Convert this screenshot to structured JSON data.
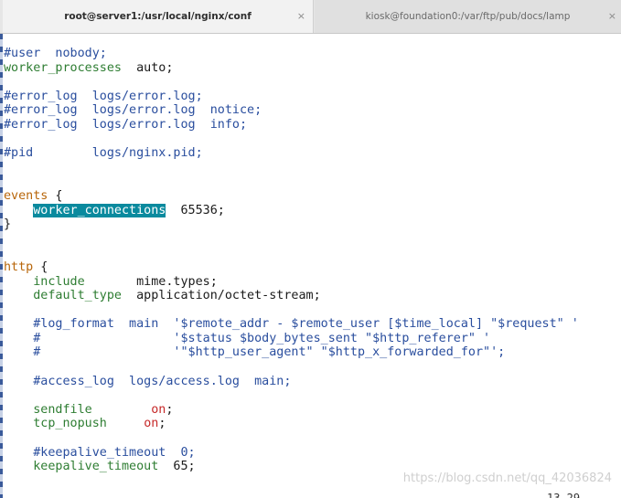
{
  "tabs": [
    {
      "title": "root@server1:/usr/local/nginx/conf",
      "close": "×",
      "active": true
    },
    {
      "title": "kiosk@foundation0:/var/ftp/pub/docs/lamp",
      "close": "×",
      "active": false
    }
  ],
  "colors": {
    "comment": "#2a4e9e",
    "directive": "#2e7d32",
    "keyword": "#b8660a",
    "value_on": "#c62828",
    "highlight_bg": "#0a8a9e"
  },
  "lines": [
    [
      {
        "t": "#user  nobody;",
        "c": "comment"
      }
    ],
    [
      {
        "t": "worker_processes",
        "c": "key"
      },
      {
        "t": "  auto;",
        "c": "plain"
      }
    ],
    [],
    [
      {
        "t": "#error_log  logs/error.log;",
        "c": "comment"
      }
    ],
    [
      {
        "t": "#error_log  logs/error.log  notice;",
        "c": "comment"
      }
    ],
    [
      {
        "t": "#error_log  logs/error.log  info;",
        "c": "comment"
      }
    ],
    [],
    [
      {
        "t": "#pid        logs/nginx.pid;",
        "c": "comment"
      }
    ],
    [],
    [],
    [
      {
        "t": "events",
        "c": "kw"
      },
      {
        "t": " {",
        "c": "plain"
      }
    ],
    [
      {
        "t": "    ",
        "c": "plain"
      },
      {
        "t": "worker_connections",
        "c": "hl"
      },
      {
        "t": "  65536;",
        "c": "plain"
      }
    ],
    [
      {
        "t": "}",
        "c": "plain"
      }
    ],
    [],
    [],
    [
      {
        "t": "http",
        "c": "kw"
      },
      {
        "t": " {",
        "c": "plain"
      }
    ],
    [
      {
        "t": "    ",
        "c": "plain"
      },
      {
        "t": "include",
        "c": "key"
      },
      {
        "t": "       mime.types;",
        "c": "plain"
      }
    ],
    [
      {
        "t": "    ",
        "c": "plain"
      },
      {
        "t": "default_type",
        "c": "key"
      },
      {
        "t": "  application/octet-stream;",
        "c": "plain"
      }
    ],
    [],
    [
      {
        "t": "    #log_format  main  '$remote_addr - $remote_user [$time_local] \"$request\" '",
        "c": "comment"
      }
    ],
    [
      {
        "t": "    #                  '$status $body_bytes_sent \"$http_referer\" '",
        "c": "comment"
      }
    ],
    [
      {
        "t": "    #                  '\"$http_user_agent\" \"$http_x_forwarded_for\"';",
        "c": "comment"
      }
    ],
    [],
    [
      {
        "t": "    #access_log  logs/access.log  main;",
        "c": "comment"
      }
    ],
    [],
    [
      {
        "t": "    ",
        "c": "plain"
      },
      {
        "t": "sendfile",
        "c": "key"
      },
      {
        "t": "        ",
        "c": "plain"
      },
      {
        "t": "on",
        "c": "red"
      },
      {
        "t": ";",
        "c": "plain"
      }
    ],
    [
      {
        "t": "    ",
        "c": "plain"
      },
      {
        "t": "tcp_nopush",
        "c": "key"
      },
      {
        "t": "     ",
        "c": "plain"
      },
      {
        "t": "on",
        "c": "red"
      },
      {
        "t": ";",
        "c": "plain"
      }
    ],
    [],
    [
      {
        "t": "    #keepalive_timeout  0;",
        "c": "comment"
      }
    ],
    [
      {
        "t": "    ",
        "c": "plain"
      },
      {
        "t": "keepalive_timeout",
        "c": "key"
      },
      {
        "t": "  65;",
        "c": "plain"
      }
    ]
  ],
  "watermark": "https://blog.csdn.net/qq_42036824",
  "cursor_position": "13,29"
}
